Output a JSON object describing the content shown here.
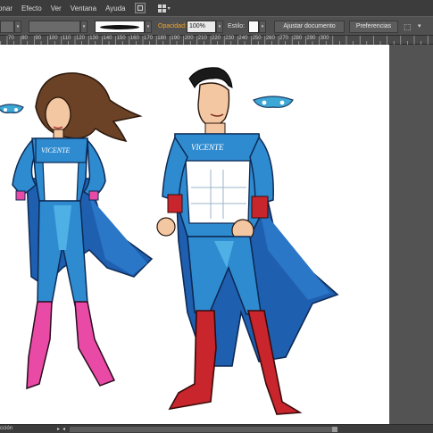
{
  "menubar": {
    "items": [
      "onar",
      "Efecto",
      "Ver",
      "Ventana",
      "Ayuda"
    ],
    "icons": [
      "bridge-icon",
      "workspace-grid-icon"
    ]
  },
  "controlbar": {
    "opacity_label": "Opacidad:",
    "opacity_value": "100%",
    "style_label": "Estilo:",
    "document_button": "Ajustar documento",
    "preferences_button": "Preferencias",
    "brush_preview": "brush-stroke",
    "accent_color": "#f5a623"
  },
  "ruler": {
    "ticks": [
      "70",
      "80",
      "90",
      "100",
      "110",
      "120",
      "130",
      "140",
      "150",
      "160",
      "170",
      "180",
      "190",
      "200",
      "210",
      "220",
      "230",
      "240",
      "250",
      "260",
      "270",
      "280",
      "290",
      "300"
    ]
  },
  "statusbar": {
    "label": "cción"
  },
  "artwork": {
    "shirt_text": "VICENTE",
    "colors": {
      "suit_blue": "#2f8bd0",
      "cape_blue": "#1f5fb0",
      "boot_red": "#c8262c",
      "boot_pink": "#e94aa6",
      "hair_brown": "#6b4226",
      "skin": "#f4c7a3"
    }
  }
}
